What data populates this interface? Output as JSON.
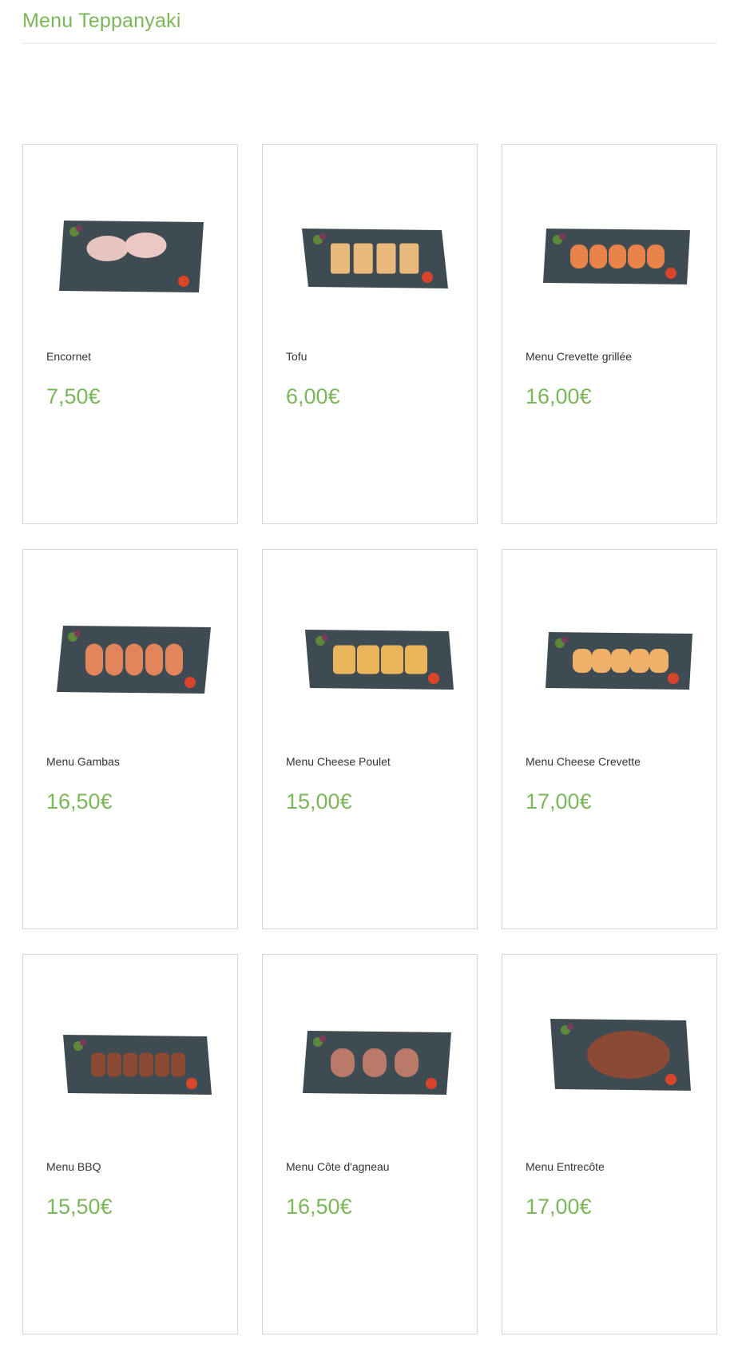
{
  "page": {
    "title": "Menu Teppanyaki"
  },
  "colors": {
    "accent": "#7cb65a",
    "card_border": "#d5d5d5",
    "slate": "#3f4b52"
  },
  "items": [
    {
      "name": "Encornet",
      "price": "7,50€",
      "dish": "squid",
      "icon": "squid-dish-icon"
    },
    {
      "name": "Tofu",
      "price": "6,00€",
      "dish": "tofu",
      "icon": "tofu-dish-icon"
    },
    {
      "name": "Menu Crevette grillée",
      "price": "16,00€",
      "dish": "shrimp-skewers",
      "icon": "grilled-shrimp-dish-icon"
    },
    {
      "name": "Menu Gambas",
      "price": "16,50€",
      "dish": "prawns",
      "icon": "prawns-dish-icon"
    },
    {
      "name": "Menu Cheese Poulet",
      "price": "15,00€",
      "dish": "cheese-chicken",
      "icon": "cheese-chicken-dish-icon"
    },
    {
      "name": "Menu Cheese Crevette",
      "price": "17,00€",
      "dish": "cheese-shrimp",
      "icon": "cheese-shrimp-dish-icon"
    },
    {
      "name": "Menu BBQ",
      "price": "15,50€",
      "dish": "bbq",
      "icon": "bbq-beef-dish-icon"
    },
    {
      "name": "Menu Côte d'agneau",
      "price": "16,50€",
      "dish": "lamb",
      "icon": "lamb-chops-dish-icon"
    },
    {
      "name": "Menu Entrecôte",
      "price": "17,00€",
      "dish": "steak",
      "icon": "steak-dish-icon"
    }
  ]
}
